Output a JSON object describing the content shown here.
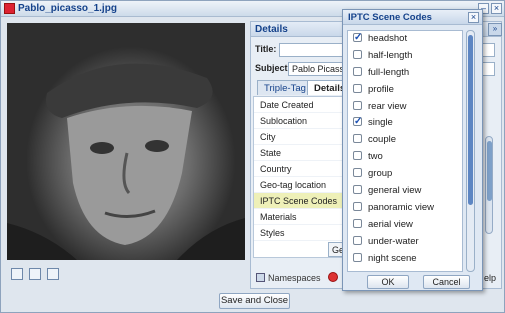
{
  "window": {
    "title": "Pablo_picasso_1.jpg"
  },
  "panel": {
    "header": "Details",
    "title_label": "Title:",
    "title_value": "",
    "subject_label": "Subject:",
    "subject_value": "Pablo Picasso",
    "tabs": [
      {
        "label": "Triple-Tag"
      },
      {
        "label": "Details"
      }
    ],
    "properties": [
      {
        "label": "Date Created"
      },
      {
        "label": "Sublocation"
      },
      {
        "label": "City"
      },
      {
        "label": "State"
      },
      {
        "label": "Country"
      },
      {
        "label": "Geo-tag location"
      },
      {
        "label": "IPTC Scene Codes"
      },
      {
        "label": "Materials"
      },
      {
        "label": "Styles"
      }
    ],
    "get_button": "Get",
    "namespaces_label": "Namespaces",
    "help_label": "elp",
    "expand_icon": "»"
  },
  "footer": {
    "save_close": "Save and Close"
  },
  "popup": {
    "title": "IPTC Scene Codes",
    "close_icon": "×",
    "items": [
      {
        "label": "headshot",
        "checked": true
      },
      {
        "label": "half-length",
        "checked": false
      },
      {
        "label": "full-length",
        "checked": false
      },
      {
        "label": "profile",
        "checked": false
      },
      {
        "label": "rear view",
        "checked": false
      },
      {
        "label": "single",
        "checked": true
      },
      {
        "label": "couple",
        "checked": false
      },
      {
        "label": "two",
        "checked": false
      },
      {
        "label": "group",
        "checked": false
      },
      {
        "label": "general view",
        "checked": false
      },
      {
        "label": "panoramic view",
        "checked": false
      },
      {
        "label": "aerial view",
        "checked": false
      },
      {
        "label": "under-water",
        "checked": false
      },
      {
        "label": "night scene",
        "checked": false
      }
    ],
    "ok": "OK",
    "cancel": "Cancel"
  },
  "colors": {
    "accent": "#15428b",
    "highlight": "#eef0b8"
  }
}
